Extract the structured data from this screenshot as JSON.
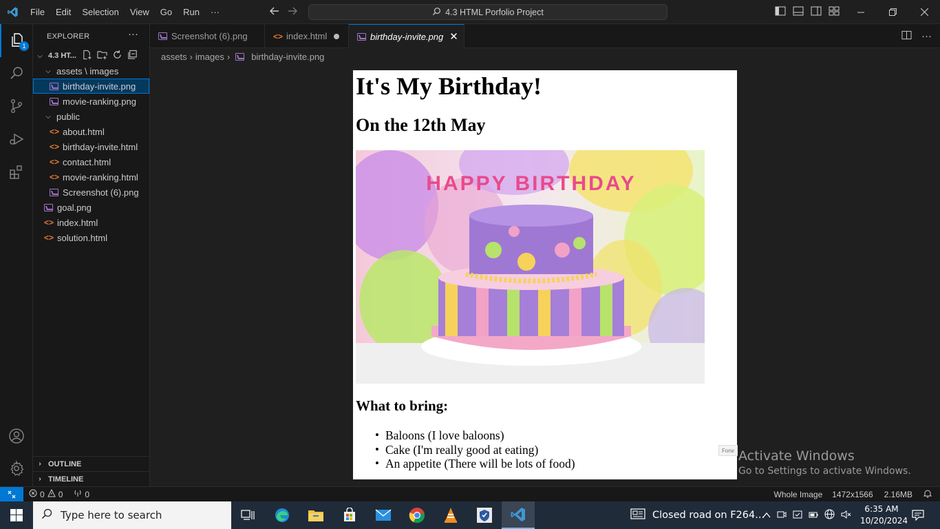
{
  "titlebar": {
    "menu": [
      "File",
      "Edit",
      "Selection",
      "View",
      "Go",
      "Run",
      "···"
    ],
    "search": "4.3 HTML Porfolio Project"
  },
  "activity": {
    "explorer_badge": "1"
  },
  "explorer": {
    "title": "EXPLORER",
    "root": "4.3 HT...",
    "items": [
      {
        "label": "assets \\ images",
        "type": "folder"
      },
      {
        "label": "birthday-invite.png",
        "type": "image",
        "selected": true
      },
      {
        "label": "movie-ranking.png",
        "type": "image"
      },
      {
        "label": "public",
        "type": "folder"
      },
      {
        "label": "about.html",
        "type": "html"
      },
      {
        "label": "birthday-invite.html",
        "type": "html"
      },
      {
        "label": "contact.html",
        "type": "html"
      },
      {
        "label": "movie-ranking.html",
        "type": "html"
      },
      {
        "label": "Screenshot (6).png",
        "type": "image"
      },
      {
        "label": "goal.png",
        "type": "image"
      },
      {
        "label": "index.html",
        "type": "html"
      },
      {
        "label": "solution.html",
        "type": "html"
      }
    ],
    "outline": "OUTLINE",
    "timeline": "TIMELINE"
  },
  "tabs": [
    {
      "label": "Screenshot (6).png",
      "type": "image"
    },
    {
      "label": "index.html",
      "type": "html",
      "modified": true
    },
    {
      "label": "birthday-invite.png",
      "type": "image",
      "active": true
    }
  ],
  "breadcrumb": [
    "assets",
    "images",
    "birthday-invite.png"
  ],
  "preview": {
    "h1": "It's My Birthday!",
    "h2": "On the 12th May",
    "cake_text": "HAPPY BIRTHDAY",
    "h3": "What to bring:",
    "list": [
      "Baloons (I love baloons)",
      "Cake (I'm really good at eating)",
      "An appetite (There will be lots of food)"
    ],
    "forward_tag": "Forw"
  },
  "activation": {
    "title": "Activate Windows",
    "subtitle": "Go to Settings to activate Windows."
  },
  "statusbar": {
    "errors": "0",
    "warnings": "0",
    "ports": "0",
    "view_mode": "Whole Image",
    "dimensions": "1472x1566",
    "size": "2.16MB"
  },
  "taskbar": {
    "search_placeholder": "Type here to search",
    "news": "Closed road on F264...",
    "time": "6:35 AM",
    "date": "10/20/2024"
  },
  "colors": {
    "accent": "#0078d4",
    "html_icon": "#e37933",
    "image_icon": "#a074c4",
    "taskbar": "#202b3a"
  }
}
